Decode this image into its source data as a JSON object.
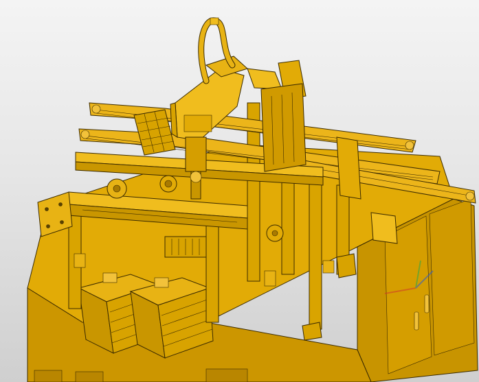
{
  "viewport": {
    "background_top": "#f4f4f4",
    "background_bottom": "#cfcfcf"
  },
  "model": {
    "body_color": "#e0a800",
    "body_light": "#f0bd1e",
    "body_dark": "#b98600",
    "edge_color": "#3a2a00"
  },
  "triad_icons": [
    "x-axis-triad-icon",
    "y-axis-triad-icon",
    "z-axis-triad-icon"
  ],
  "axis_colors": {
    "x": "#d23a2a",
    "y": "#2aa84a",
    "z": "#2a5ad2"
  }
}
